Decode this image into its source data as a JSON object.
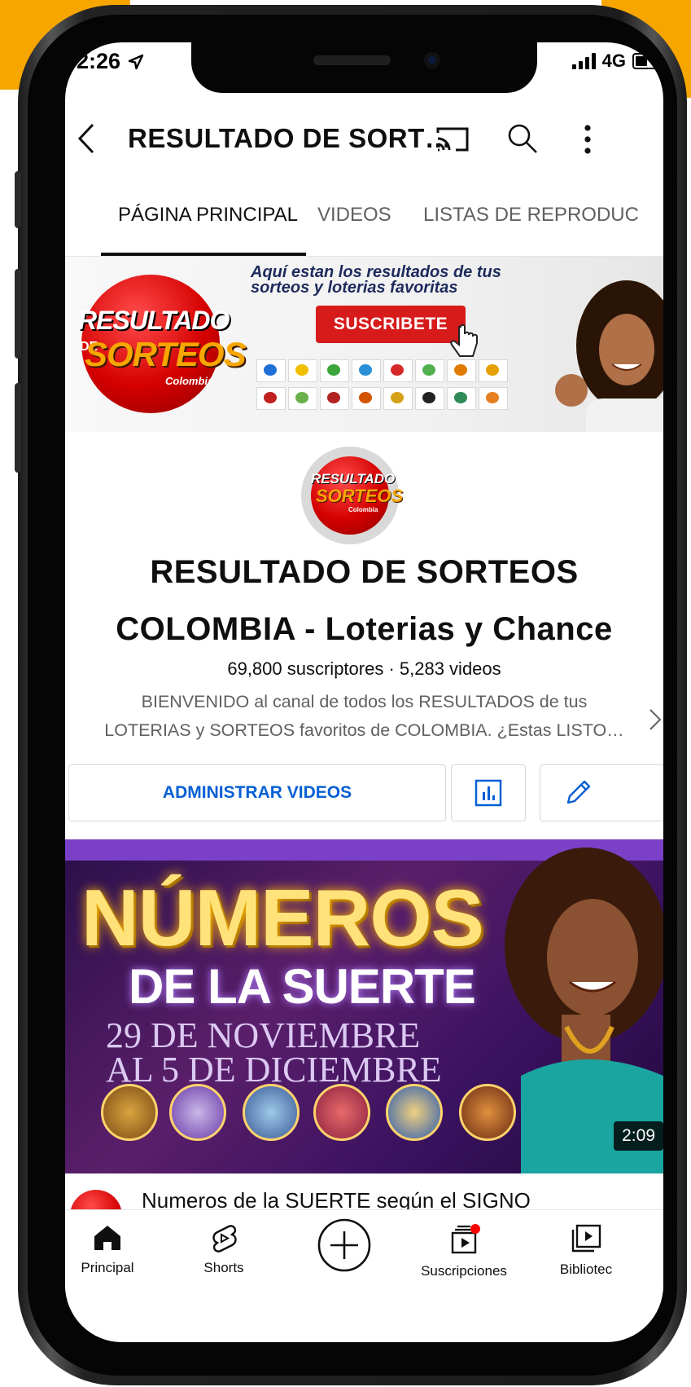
{
  "status_bar": {
    "time": "2:26",
    "network": "4G"
  },
  "header": {
    "title": "RESULTADO DE SORT…"
  },
  "tabs": [
    {
      "label": "PÁGINA PRINCIPAL"
    },
    {
      "label": "VIDEOS"
    },
    {
      "label": "LISTAS DE REPRODUC"
    }
  ],
  "banner": {
    "logo_line1": "RESULTADO",
    "logo_de": "DE",
    "logo_line2": "SORTEOS",
    "logo_country": "Colombia",
    "tagline": "Aquí estan los resultados de tus sorteos y loterias favoritas",
    "subscribe_label": "SUSCRIBETE"
  },
  "channel": {
    "avatar_line1": "RESULTADO",
    "avatar_de": "DE",
    "avatar_line2": "SORTEOS",
    "avatar_country": "Colombia",
    "name_line1": "RESULTADO DE SORTEOS",
    "name_line2": "COLOMBIA - Loterias y Chance",
    "stats": "69,800 suscriptores · 5,283 videos",
    "description_line1": "BIENVENIDO al canal de todos los RESULTADOS de tus",
    "description_line2": "LOTERIAS y SORTEOS favoritos de COLOMBIA. ¿Estas LISTO…",
    "manage_label": "ADMINISTRAR VIDEOS"
  },
  "featured_video": {
    "thumb_title1": "NÚMEROS",
    "thumb_title2": "DE LA SUERTE",
    "thumb_date1": "29 DE NOVIEMBRE",
    "thumb_date2": "AL 5 DE DICIEMBRE",
    "duration": "2:09",
    "title": "Numeros de la SUERTE según el SIGNO"
  },
  "bottom_nav": [
    {
      "label": "Principal",
      "icon": "home-icon"
    },
    {
      "label": "Shorts",
      "icon": "shorts-icon"
    },
    {
      "label": "",
      "icon": "add-icon"
    },
    {
      "label": "Suscripciones",
      "icon": "subscriptions-icon"
    },
    {
      "label": "Bibliotec",
      "icon": "library-icon"
    }
  ],
  "colors": {
    "accent_orange": "#f7a600",
    "brand_red": "#d71a1a",
    "link_blue": "#065fd4",
    "thumb_purple": "#7a40c8"
  }
}
